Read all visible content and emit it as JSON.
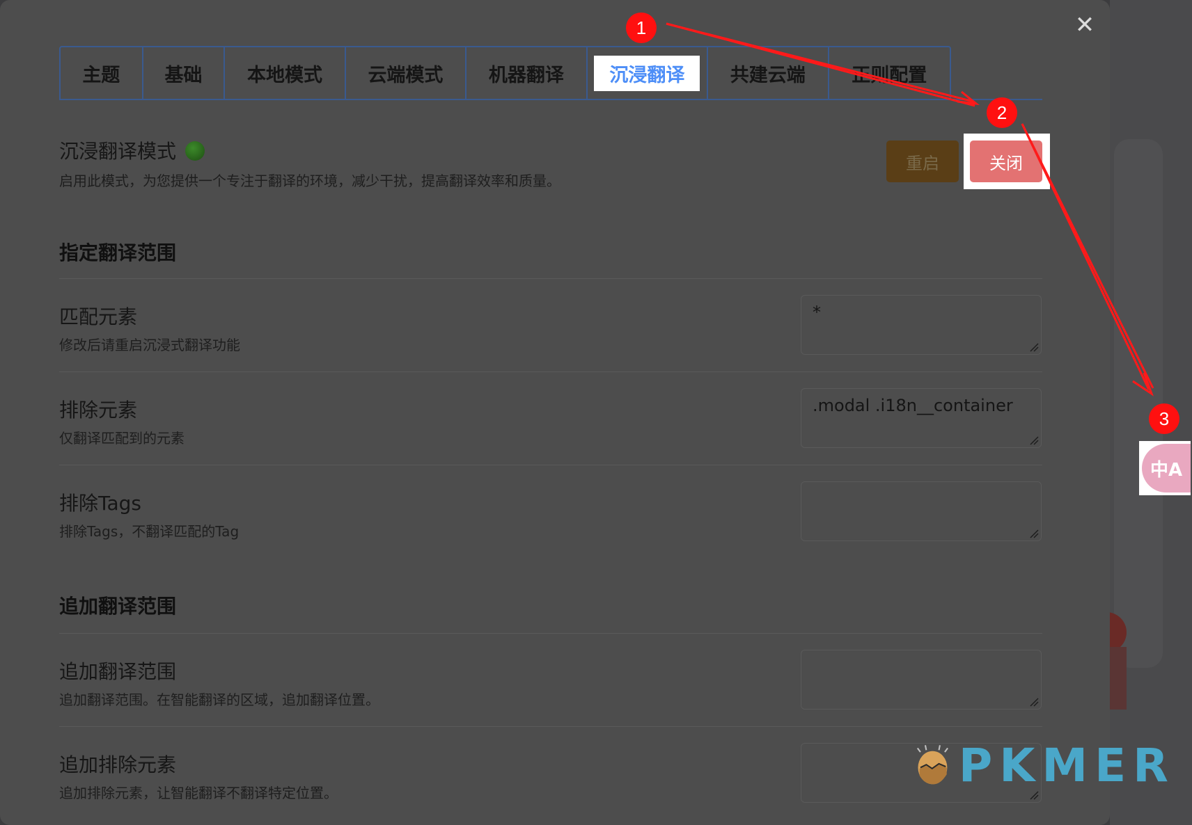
{
  "modal": {
    "close_icon": "✕",
    "tabs": [
      {
        "label": "主题",
        "active": false
      },
      {
        "label": "基础",
        "active": false
      },
      {
        "label": "本地模式",
        "active": false
      },
      {
        "label": "云端模式",
        "active": false
      },
      {
        "label": "机器翻译",
        "active": false
      },
      {
        "label": "沉浸翻译",
        "active": true
      },
      {
        "label": "共建云端",
        "active": false
      },
      {
        "label": "正则配置",
        "active": false
      }
    ],
    "immersive": {
      "title": "沉浸翻译模式",
      "status_icon": "green-dot",
      "description": "启用此模式，为您提供一个专注于翻译的环境，减少干扰，提高翻译效率和质量。",
      "restart_label": "重启",
      "close_label": "关闭"
    },
    "scope": {
      "heading": "指定翻译范围",
      "rows": [
        {
          "title": "匹配元素",
          "desc": "修改后请重启沉浸式翻译功能",
          "value": "*"
        },
        {
          "title": "排除元素",
          "desc": "仅翻译匹配到的元素",
          "value": ".modal .i18n__container"
        },
        {
          "title": "排除Tags",
          "desc": "排除Tags，不翻译匹配的Tag",
          "value": ""
        }
      ]
    },
    "append": {
      "heading": "追加翻译范围",
      "rows": [
        {
          "title": "追加翻译范围",
          "desc": "追加翻译范围。在智能翻译的区域，追加翻译位置。",
          "value": ""
        },
        {
          "title": "追加排除元素",
          "desc": "追加排除元素，让智能翻译不翻译特定位置。",
          "value": ""
        }
      ]
    }
  },
  "floating_button": {
    "icon": "translate-icon",
    "glyph": "中A"
  },
  "annotations": {
    "badges": [
      "1",
      "2",
      "3"
    ],
    "color": "#ff1010"
  },
  "watermark": {
    "text": "PKMER"
  }
}
